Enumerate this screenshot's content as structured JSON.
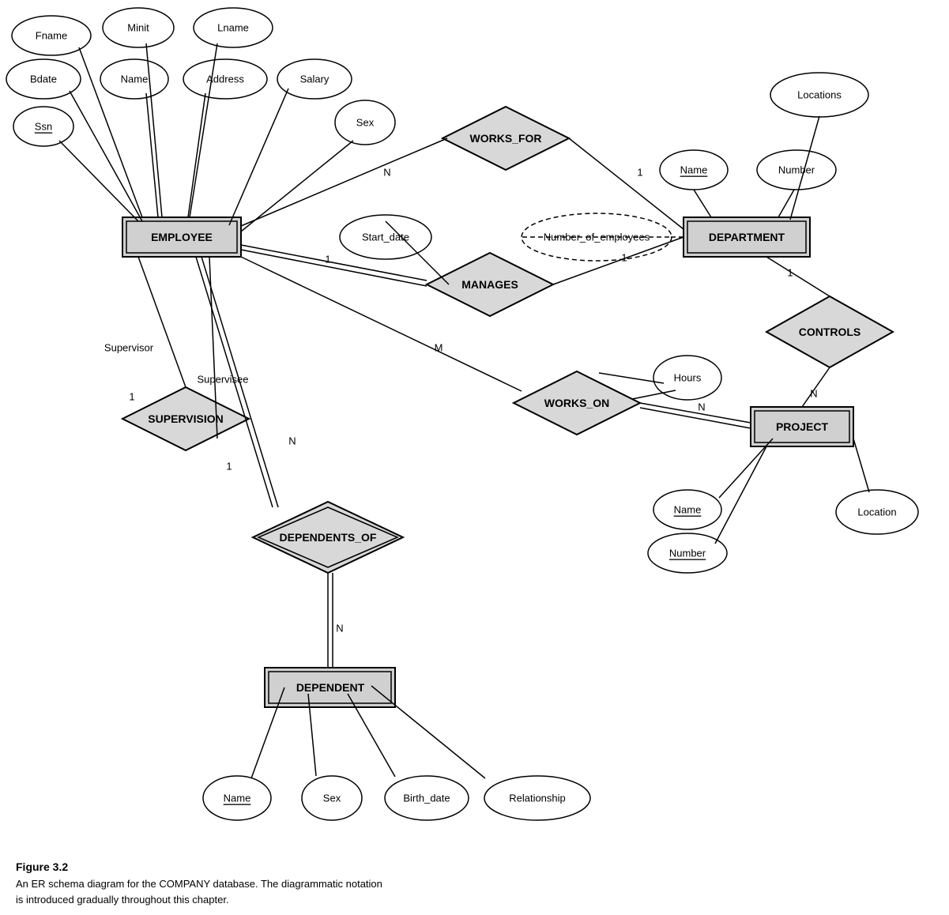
{
  "diagram": {
    "title": "Figure 3.2",
    "caption_line1": "An ER schema diagram for the COMPANY database. The diagrammatic notation",
    "caption_line2": "is introduced gradually throughout this chapter."
  }
}
